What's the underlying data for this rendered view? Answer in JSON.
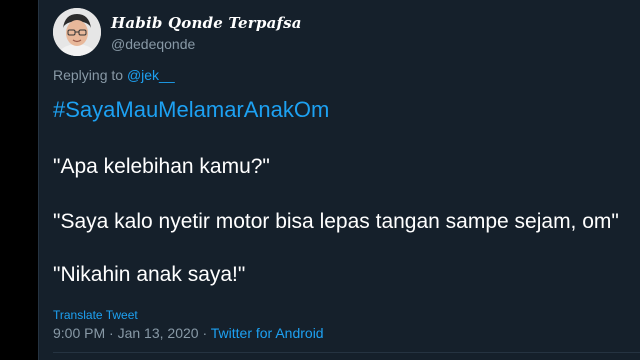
{
  "tweet": {
    "author": {
      "display_name": "Habib Qonde Terpafsa",
      "handle": "@dedeqonde"
    },
    "reply": {
      "prefix": "Replying to",
      "mention": "@jek__"
    },
    "hashtag": "#SayaMauMelamarAnakOm",
    "lines": [
      "\"Apa kelebihan kamu?\"",
      "\"Saya kalo nyetir motor bisa lepas tangan sampe sejam, om\"",
      "\"Nikahin anak saya!\""
    ],
    "translate_label": "Translate Tweet",
    "time": "9:00 PM",
    "date": "Jan 13, 2020",
    "separator": "·",
    "source": "Twitter for Android"
  },
  "colors": {
    "background": "#15202b",
    "accent": "#1da1f2",
    "secondary_text": "#8899a6",
    "primary_text": "#ffffff"
  }
}
